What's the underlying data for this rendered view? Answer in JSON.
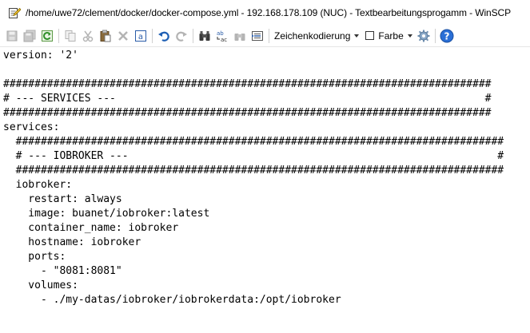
{
  "window": {
    "title": "/home/uwe72/clement/docker/docker-compose.yml - 192.168.178.109 (NUC) - Textbearbeitungsprogamm - WinSCP",
    "icon": "notepad-pencil-icon"
  },
  "toolbar": {
    "buttons": [
      {
        "name": "save-icon"
      },
      {
        "name": "save-all-icon"
      },
      {
        "name": "reload-icon"
      },
      {
        "name": "copy-icon"
      },
      {
        "name": "cut-icon"
      },
      {
        "name": "paste-icon"
      },
      {
        "name": "delete-icon"
      },
      {
        "name": "select-all-icon"
      },
      {
        "name": "undo-icon"
      },
      {
        "name": "redo-icon"
      },
      {
        "name": "find-icon"
      },
      {
        "name": "replace-icon"
      },
      {
        "name": "find-next-icon"
      },
      {
        "name": "goto-line-icon"
      }
    ],
    "encoding_label": "Zeichenkodierung",
    "color_label": "Farbe",
    "color_checked": false,
    "settings_icon": "gear-icon",
    "help_icon": "help-icon"
  },
  "editor": {
    "lines": [
      "version: '2'",
      "",
      "##############################################################################",
      "# --- SERVICES ---                                                           #",
      "##############################################################################",
      "services:",
      "  ##############################################################################",
      "  # --- IOBROKER ---                                                           #",
      "  ##############################################################################",
      "  iobroker:",
      "    restart: always",
      "    image: buanet/iobroker:latest",
      "    container_name: iobroker",
      "    hostname: iobroker",
      "    ports:",
      "      - \"8081:8081\"",
      "    volumes:",
      "      - ./my-datas/iobroker/iobrokerdata:/opt/iobroker"
    ]
  },
  "colors": {
    "disabled_icon": "#b4b4b4",
    "blue_icon": "#1e5fb4",
    "help_blue": "#2a6fd6"
  }
}
